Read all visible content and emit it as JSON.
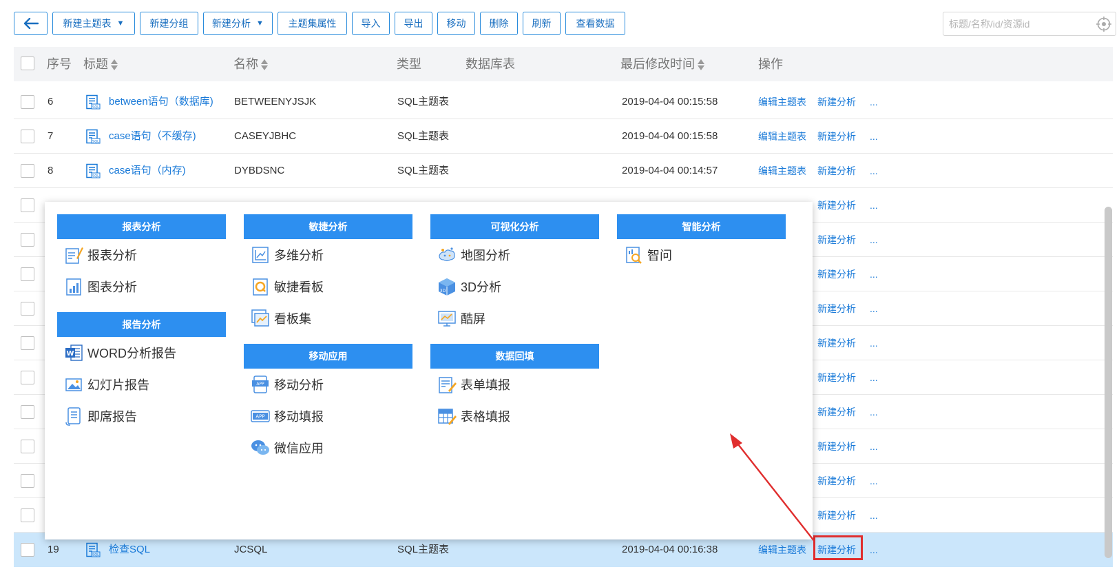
{
  "toolbar": {
    "back_label": "",
    "new_theme_table": "新建主题表",
    "new_group": "新建分组",
    "new_analysis": "新建分析",
    "theme_set_props": "主题集属性",
    "import": "导入",
    "export": "导出",
    "move": "移动",
    "delete": "删除",
    "refresh": "刷新",
    "view_data": "查看数据"
  },
  "search": {
    "placeholder": "标题/名称/id/资源id",
    "value": ""
  },
  "table": {
    "headers": {
      "index": "序号",
      "title": "标题",
      "name": "名称",
      "type": "类型",
      "db_table": "数据库表",
      "modified": "最后修改时间",
      "actions": "操作"
    },
    "op_edit": "编辑主题表",
    "op_new_analysis": "新建分析",
    "op_more": "...",
    "rows": [
      {
        "index": "6",
        "title": "between语句（数据库)",
        "name": "BETWEENYJSJK",
        "type": "SQL主题表",
        "modified": "2019-04-04 00:15:58"
      },
      {
        "index": "7",
        "title": "case语句（不缓存)",
        "name": "CASEYJBHC",
        "type": "SQL主题表",
        "modified": "2019-04-04 00:15:58"
      },
      {
        "index": "8",
        "title": "case语句（内存)",
        "name": "DYBDSNC",
        "type": "SQL主题表",
        "modified": "2019-04-04 00:14:57"
      },
      {
        "index": "19",
        "title": "检查SQL",
        "name": "JCSQL",
        "type": "SQL主题表",
        "modified": "2019-04-04 00:16:38"
      }
    ],
    "covered_rows_actions": "新建分析"
  },
  "popup": {
    "sections": {
      "report_analysis": {
        "title": "报表分析",
        "items": [
          "报表分析",
          "图表分析"
        ]
      },
      "report_doc": {
        "title": "报告分析",
        "items": [
          "WORD分析报告",
          "幻灯片报告",
          "即席报告"
        ]
      },
      "agile": {
        "title": "敏捷分析",
        "items": [
          "多维分析",
          "敏捷看板",
          "看板集"
        ]
      },
      "mobile": {
        "title": "移动应用",
        "items": [
          "移动分析",
          "移动填报",
          "微信应用"
        ]
      },
      "visual": {
        "title": "可视化分析",
        "items": [
          "地图分析",
          "3D分析",
          "酷屏"
        ]
      },
      "fill": {
        "title": "数据回填",
        "items": [
          "表单填报",
          "表格填报"
        ]
      },
      "smart": {
        "title": "智能分析",
        "items": [
          "智问"
        ]
      }
    }
  },
  "colors": {
    "accent": "#2d8ff0",
    "link": "#1a7ad8",
    "selected_row": "#cbe6fb",
    "annotation": "#e02e2e"
  },
  "icons": {
    "back": "arrow-left-icon",
    "locate": "locate-icon",
    "sql": "sql-file-icon"
  }
}
